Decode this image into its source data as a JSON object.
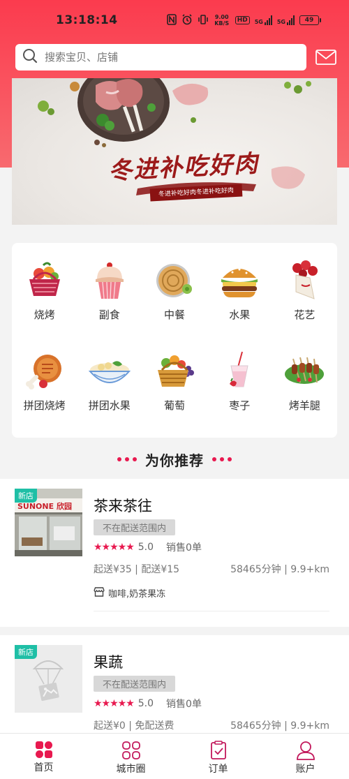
{
  "status_bar": {
    "time": "13:18:14",
    "net_speed": "9.00 KB/S",
    "hd": "HD",
    "network_1": "5G",
    "network_2": "5G",
    "battery": "49"
  },
  "search": {
    "placeholder": "搜索宝贝、店铺"
  },
  "banner": {
    "title": "冬进补吃好肉",
    "subtitle": "冬进补吃好肉冬进补吃好肉"
  },
  "categories": [
    {
      "label": "烧烤",
      "icon": "fruit-basket-icon"
    },
    {
      "label": "副食",
      "icon": "cupcake-icon"
    },
    {
      "label": "中餐",
      "icon": "pancake-icon"
    },
    {
      "label": "水果",
      "icon": "burger-icon"
    },
    {
      "label": "花艺",
      "icon": "flower-bouquet-icon"
    },
    {
      "label": "拼团烧烤",
      "icon": "drumstick-icon"
    },
    {
      "label": "拼团水果",
      "icon": "noodle-bowl-icon"
    },
    {
      "label": "葡萄",
      "icon": "grape-basket-icon"
    },
    {
      "label": "枣子",
      "icon": "smoothie-icon"
    },
    {
      "label": "烤羊腿",
      "icon": "skewers-icon"
    }
  ],
  "recommend": {
    "title": "为你推荐"
  },
  "stores": [
    {
      "badge": "新店",
      "name": "茶来茶往",
      "range_tag": "不在配送范围内",
      "rating": "5.0",
      "sales": "销售0单",
      "fee": "起送¥35 | 配送¥15",
      "distance": "58465分钟 | 9.9+km",
      "category": "咖啡,奶茶果冻",
      "thumb_text": "SUNONE 欣园"
    },
    {
      "badge": "新店",
      "name": "果蔬",
      "range_tag": "不在配送范围内",
      "rating": "5.0",
      "sales": "销售0单",
      "fee": "起送¥0 | 免配送费",
      "distance": "58465分钟 | 9.9+km"
    }
  ],
  "tabbar": [
    {
      "label": "首页",
      "icon": "home-grid-icon",
      "active": true
    },
    {
      "label": "城市圈",
      "icon": "city-circle-icon",
      "active": false
    },
    {
      "label": "订单",
      "icon": "order-clipboard-icon",
      "active": false
    },
    {
      "label": "账户",
      "icon": "account-person-icon",
      "active": false
    }
  ],
  "colors": {
    "header_red": "#fb3b4e",
    "accent_pink": "#e8194f",
    "new_badge": "#1fbfa6"
  }
}
